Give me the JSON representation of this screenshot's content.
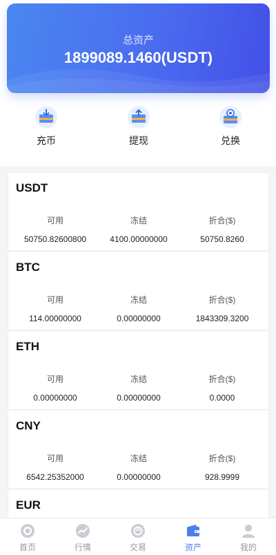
{
  "hero": {
    "label": "总资产",
    "value": "1899089.1460(USDT)"
  },
  "actions": [
    {
      "label": "充币",
      "icon": "deposit-icon"
    },
    {
      "label": "提现",
      "icon": "withdraw-icon"
    },
    {
      "label": "兑换",
      "icon": "exchange-icon"
    }
  ],
  "columns": {
    "available": "可用",
    "frozen": "冻结",
    "converted": "折合($)"
  },
  "assets": [
    {
      "name": "USDT",
      "available": "50750.82600800",
      "frozen": "4100.00000000",
      "converted": "50750.8260"
    },
    {
      "name": "BTC",
      "available": "114.00000000",
      "frozen": "0.00000000",
      "converted": "1843309.3200"
    },
    {
      "name": "ETH",
      "available": "0.00000000",
      "frozen": "0.00000000",
      "converted": "0.0000"
    },
    {
      "name": "CNY",
      "available": "6542.25352000",
      "frozen": "0.00000000",
      "converted": "928.9999"
    },
    {
      "name": "EUR"
    }
  ],
  "tabs": [
    {
      "label": "首页",
      "icon": "home-icon"
    },
    {
      "label": "行情",
      "icon": "market-icon"
    },
    {
      "label": "交易",
      "icon": "trade-icon"
    },
    {
      "label": "资产",
      "icon": "wallet-icon"
    },
    {
      "label": "我的",
      "icon": "user-icon"
    }
  ],
  "colors": {
    "accent": "#4a7ff0",
    "tab_inactive": "#999999",
    "hero_start": "#4a87f0",
    "hero_end": "#4350e6"
  }
}
